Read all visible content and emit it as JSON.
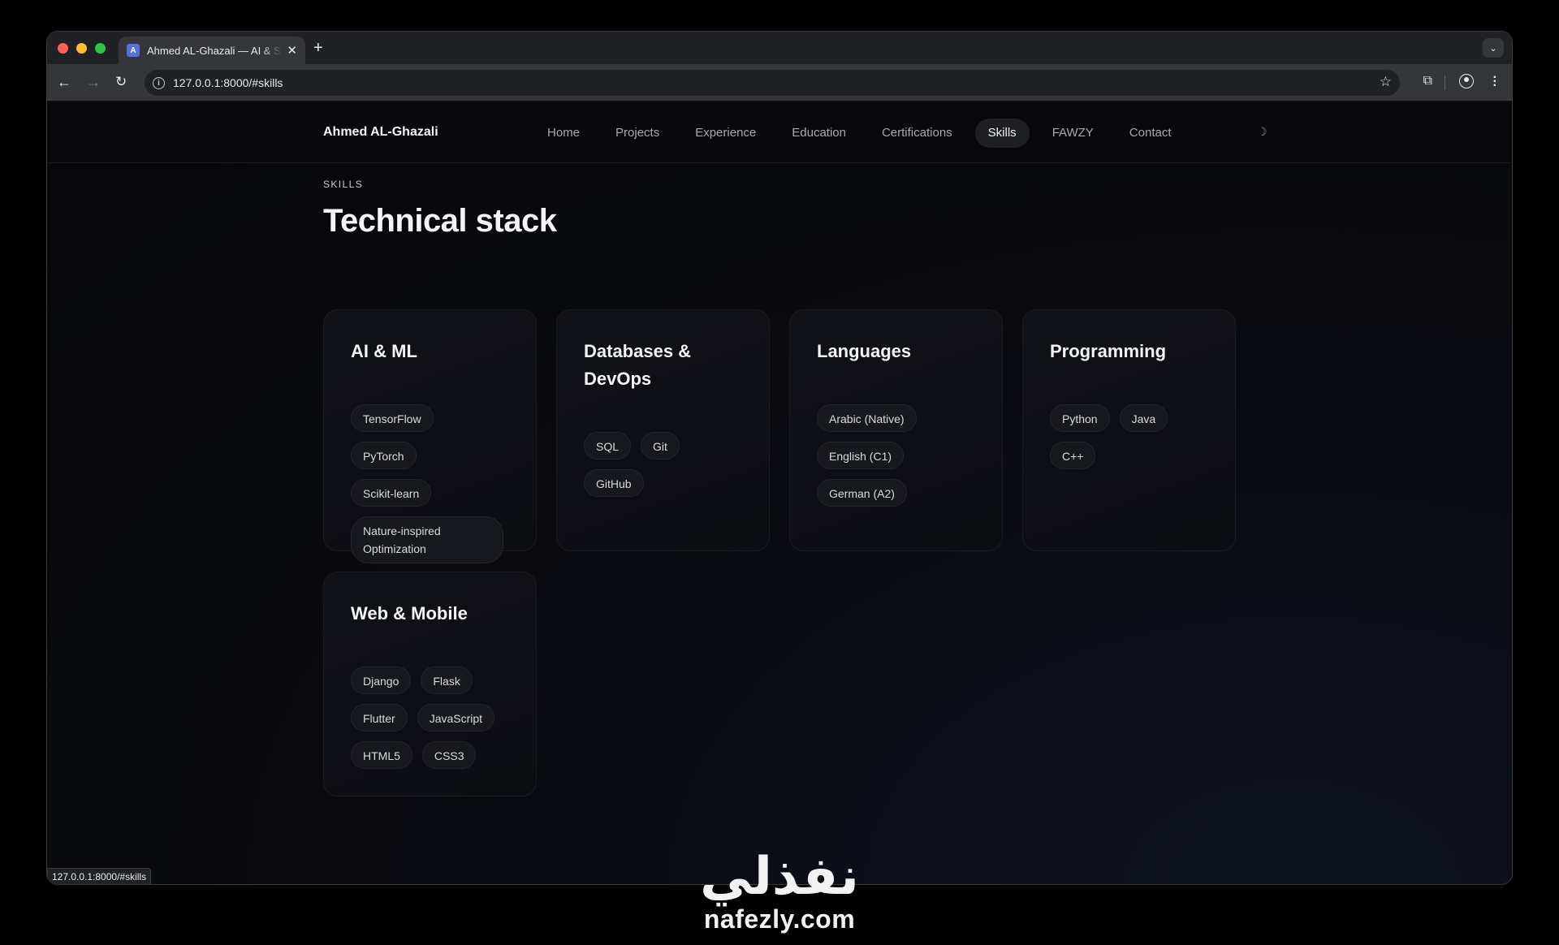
{
  "browser": {
    "tab_title": "Ahmed AL-Ghazali — AI & Software Engineer",
    "tab_favicon": "A",
    "tab_close": "✕",
    "new_tab": "+",
    "url": "127.0.0.1:8000/#skills",
    "status_url": "127.0.0.1:8000/#skills",
    "icons": [
      "back-arrow-icon",
      "forward-arrow-icon",
      "reload-icon",
      "info-icon",
      "star-icon",
      "extensions-icon",
      "profile-icon",
      "menu-icon",
      "tab-search-icon"
    ]
  },
  "site": {
    "brand": "Ahmed AL-Ghazali",
    "nav": [
      {
        "label": "Home"
      },
      {
        "label": "Projects"
      },
      {
        "label": "Experience"
      },
      {
        "label": "Education"
      },
      {
        "label": "Certifications"
      },
      {
        "label": "Skills",
        "active": true
      },
      {
        "label": "FAWZY"
      },
      {
        "label": "Contact"
      }
    ],
    "theme_toggle": "☽"
  },
  "section": {
    "eyebrow": "SKILLS",
    "title": "Technical stack",
    "cards": [
      {
        "title": "AI & ML",
        "chips": [
          "TensorFlow",
          "PyTorch",
          "Scikit-learn",
          "Nature-inspired Optimization"
        ]
      },
      {
        "title": "Databases & DevOps",
        "chips": [
          "SQL",
          "Git",
          "GitHub"
        ]
      },
      {
        "title": "Languages",
        "chips": [
          "Arabic (Native)",
          "English (C1)",
          "German (A2)"
        ]
      },
      {
        "title": "Programming",
        "chips": [
          "Python",
          "Java",
          "C++"
        ]
      },
      {
        "title": "Web & Mobile",
        "chips": [
          "Django",
          "Flask",
          "Flutter",
          "JavaScript",
          "HTML5",
          "CSS3"
        ]
      }
    ]
  },
  "watermark": {
    "arabic": "نفذلي",
    "latin": "nafezly.com"
  },
  "colors": {
    "accent_chip_bg": "#17181d",
    "page_bg": "#0a0b10",
    "text": "#f3f4f6"
  }
}
